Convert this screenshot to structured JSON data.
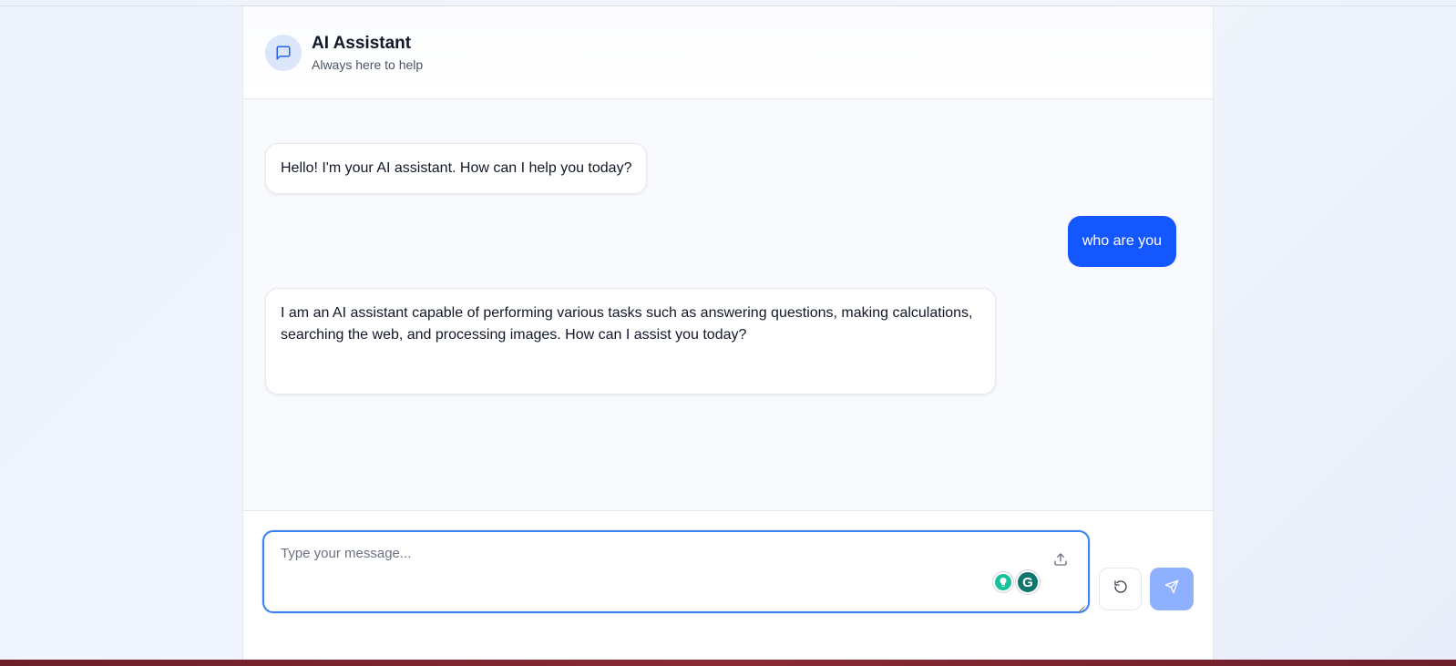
{
  "header": {
    "title": "AI Assistant",
    "subtitle": "Always here to help",
    "avatar_icon": "chat-bubble-icon"
  },
  "messages": [
    {
      "role": "assistant",
      "text": "Hello! I'm your AI assistant. How can I help you today?"
    },
    {
      "role": "user",
      "text": "who are you"
    },
    {
      "role": "assistant",
      "text": "I am an AI assistant capable of performing various tasks such as answering questions, making calculations, searching the web, and processing images. How can I assist you today?"
    }
  ],
  "composer": {
    "placeholder": "Type your message...",
    "value": "",
    "upload_icon": "upload-icon",
    "reset_icon": "refresh-icon",
    "send_icon": "send-icon",
    "grammar_logo_letter": "G"
  },
  "colors": {
    "accent": "#1557ff",
    "send_disabled": "#8fb0ff",
    "focus_ring": "#3b82f6"
  }
}
